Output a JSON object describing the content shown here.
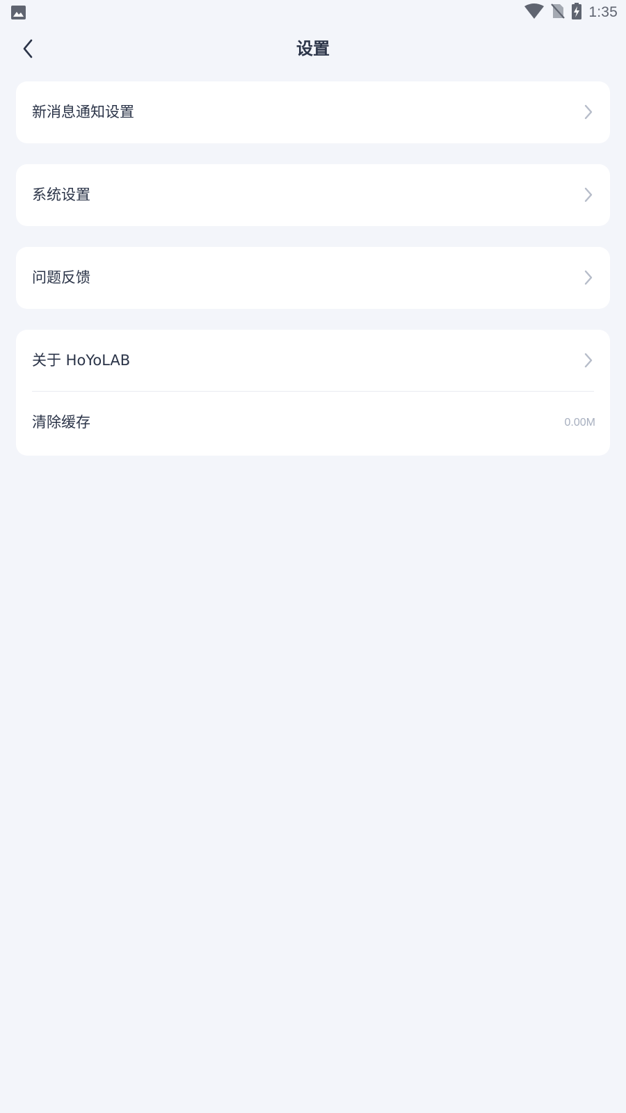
{
  "status_bar": {
    "time": "1:35",
    "left_icon": "image-notification-icon",
    "right_icons": [
      "wifi-icon",
      "no-sim-icon",
      "battery-charging-icon"
    ]
  },
  "header": {
    "title": "设置",
    "back_icon": "chevron-left-icon"
  },
  "settings": {
    "notifications": {
      "label": "新消息通知设置"
    },
    "system": {
      "label": "系统设置"
    },
    "feedback": {
      "label": "问题反馈"
    },
    "about": {
      "label": "关于 HoYoLAB"
    },
    "clear_cache": {
      "label": "清除缓存",
      "value": "0.00M"
    }
  },
  "colors": {
    "background": "#f3f5fa",
    "card": "#ffffff",
    "text": "#2b3448",
    "muted": "#a7afbf",
    "chevron": "#b6bcc9"
  }
}
